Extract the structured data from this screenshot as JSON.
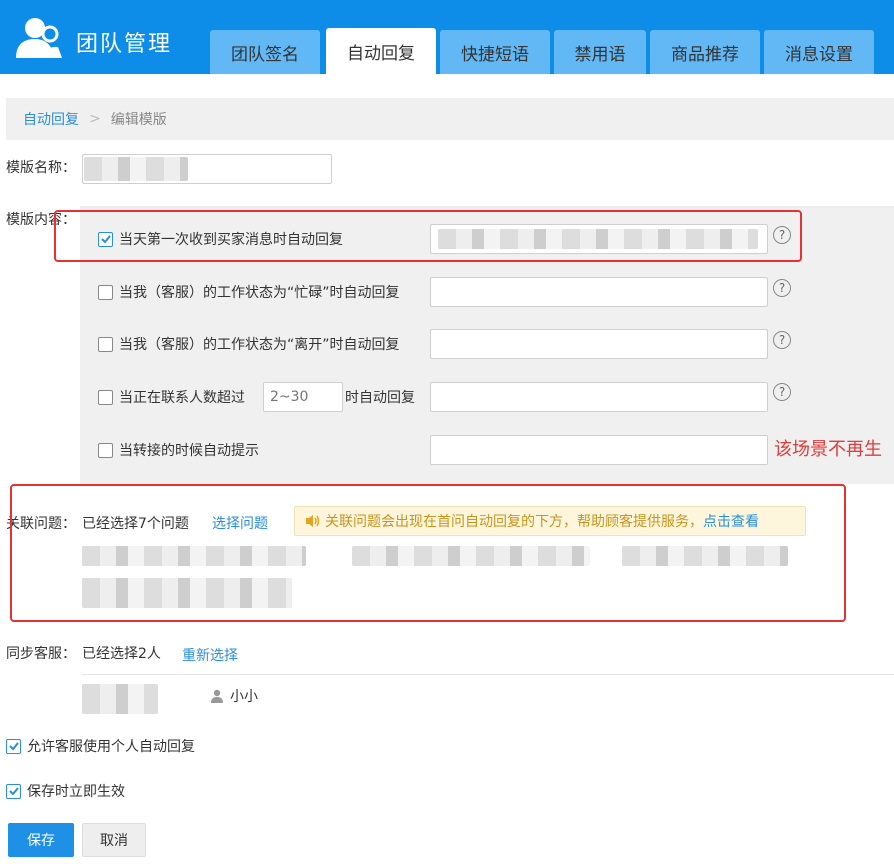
{
  "app": {
    "title": "团队管理"
  },
  "tabs": [
    {
      "label": "团队签名"
    },
    {
      "label": "自动回复"
    },
    {
      "label": "快捷短语"
    },
    {
      "label": "禁用语"
    },
    {
      "label": "商品推荐"
    },
    {
      "label": "消息设置"
    }
  ],
  "breadcrumb": {
    "link": "自动回复",
    "separator": ">",
    "current": "编辑模版"
  },
  "template_name": {
    "label": "模版名称："
  },
  "template_content": {
    "label": "模版内容：",
    "rows": [
      {
        "label": "当天第一次收到买家消息时自动回复",
        "checked": true
      },
      {
        "label": "当我（客服）的工作状态为“忙碌”时自动回复",
        "checked": false
      },
      {
        "label": "当我（客服）的工作状态为“离开”时自动回复",
        "checked": false
      },
      {
        "label_before": "当正在联系人数超过",
        "placeholder": "2~30",
        "label_after": "时自动回复",
        "checked": false
      },
      {
        "label": "当转接的时候自动提示",
        "checked": false
      }
    ],
    "help_glyph": "?",
    "scenario_warning": "该场景不再生"
  },
  "related_questions": {
    "label": "关联问题：",
    "status": "已经选择7个问题",
    "select_link": "选择问题",
    "notice_text": "关联问题会出现在首问自动回复的下方，帮助顾客提供服务，",
    "notice_link": "点击查看"
  },
  "sync_service": {
    "label": "同步客服：",
    "status": "已经选择2人",
    "reselect_link": "重新选择",
    "member_name": "小小"
  },
  "options": {
    "allow_personal": {
      "label": "允许客服使用个人自动回复",
      "checked": true
    },
    "save_effective": {
      "label": "保存时立即生效",
      "checked": true
    }
  },
  "actions": {
    "save": "保存",
    "cancel": "取消"
  },
  "colors": {
    "header": "#0d8de8",
    "tab": "#61b8f5",
    "accent": "#2b8ed8",
    "highlight": "#e53232"
  }
}
